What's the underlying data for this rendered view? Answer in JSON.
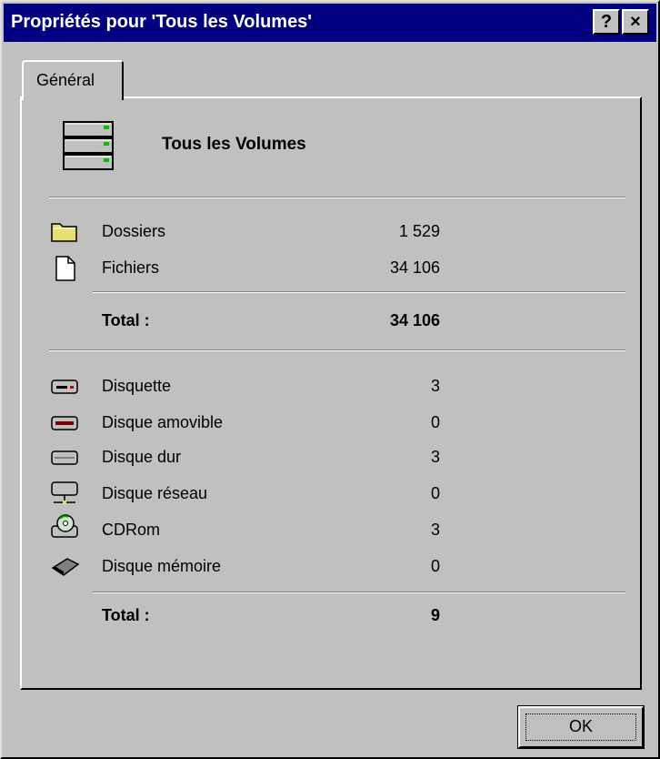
{
  "window": {
    "title": "Propriétés pour 'Tous les Volumes'",
    "help_button": "?",
    "close_button": "×",
    "titlebar_color": "#000080"
  },
  "tabs": [
    {
      "label": "Général"
    }
  ],
  "header": {
    "icon": "server-icon",
    "name": "Tous les Volumes"
  },
  "files_section": {
    "rows": [
      {
        "icon": "folder-icon",
        "label": "Dossiers",
        "value": "1 529"
      },
      {
        "icon": "file-icon",
        "label": "Fichiers",
        "value": "34 106"
      }
    ],
    "total_label": "Total :",
    "total_value": "34 106"
  },
  "drives_section": {
    "rows": [
      {
        "icon": "floppy-drive-icon",
        "label": "Disquette",
        "value": "3"
      },
      {
        "icon": "removable-drive-icon",
        "label": "Disque amovible",
        "value": "0"
      },
      {
        "icon": "hard-drive-icon",
        "label": "Disque dur",
        "value": "3"
      },
      {
        "icon": "network-drive-icon",
        "label": "Disque réseau",
        "value": "0"
      },
      {
        "icon": "cdrom-icon",
        "label": "CDRom",
        "value": "3"
      },
      {
        "icon": "memory-card-icon",
        "label": "Disque mémoire",
        "value": "0"
      }
    ],
    "total_label": "Total :",
    "total_value": "9"
  },
  "buttons": {
    "ok": "OK"
  }
}
